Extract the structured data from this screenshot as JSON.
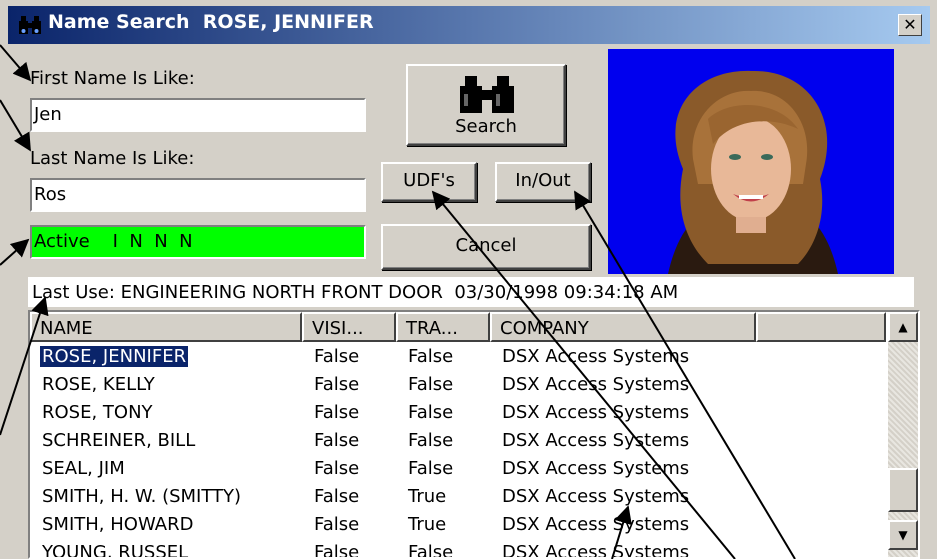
{
  "window": {
    "title": "Name Search  ROSE, JENNIFER",
    "close_label": "✕"
  },
  "form": {
    "first_name_label": "First Name Is Like:",
    "first_name_value": "Jen",
    "last_name_label": "Last Name Is Like:",
    "last_name_value": "Ros",
    "status_value": "Active    I  N  N  N",
    "last_use": "Last Use: ENGINEERING NORTH FRONT DOOR  03/30/1998 09:34:18 AM"
  },
  "buttons": {
    "search": "Search",
    "udfs": "UDF's",
    "inout": "In/Out",
    "cancel": "Cancel"
  },
  "table": {
    "headers": [
      "NAME",
      "VISI...",
      "TRA...",
      "COMPANY",
      ""
    ],
    "rows": [
      {
        "name": "ROSE, JENNIFER",
        "visitor": "False",
        "trace": "False",
        "company": "DSX Access Systems",
        "selected": true
      },
      {
        "name": "ROSE, KELLY",
        "visitor": "False",
        "trace": "False",
        "company": "DSX Access Systems"
      },
      {
        "name": "ROSE, TONY",
        "visitor": "False",
        "trace": "False",
        "company": "DSX Access Systems"
      },
      {
        "name": "SCHREINER, BILL",
        "visitor": "False",
        "trace": "False",
        "company": "DSX Access Systems"
      },
      {
        "name": "SEAL, JIM",
        "visitor": "False",
        "trace": "False",
        "company": "DSX Access Systems"
      },
      {
        "name": "SMITH, H. W. (SMITTY)",
        "visitor": "False",
        "trace": "True",
        "company": "DSX Access Systems"
      },
      {
        "name": "SMITH, HOWARD",
        "visitor": "False",
        "trace": "True",
        "company": "DSX Access Systems"
      },
      {
        "name": "YOUNG, RUSSEL",
        "visitor": "False",
        "trace": "False",
        "company": "DSX Access Systems"
      }
    ]
  },
  "colors": {
    "status_bg": "#00ff00",
    "photo_bg": "#0000ee",
    "selection": "#0a246a"
  },
  "icons": [
    "binoculars-icon",
    "close-icon",
    "scroll-up-icon",
    "scroll-down-icon"
  ]
}
